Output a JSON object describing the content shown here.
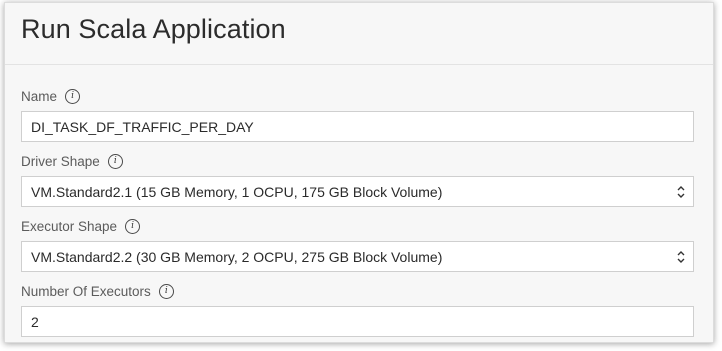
{
  "dialog": {
    "title": "Run Scala Application"
  },
  "fields": {
    "name": {
      "label": "Name",
      "value": "DI_TASK_DF_TRAFFIC_PER_DAY"
    },
    "driver_shape": {
      "label": "Driver Shape",
      "value": "VM.Standard2.1 (15 GB Memory, 1 OCPU, 175 GB Block Volume)"
    },
    "executor_shape": {
      "label": "Executor Shape",
      "value": "VM.Standard2.2 (30 GB Memory, 2 OCPU, 275 GB Block Volume)"
    },
    "num_executors": {
      "label": "Number Of Executors",
      "value": "2"
    }
  },
  "icons": {
    "info": "info-icon",
    "select_arrows": "chevron-up-down-icon"
  },
  "colors": {
    "panel_bg": "#f7f7f7",
    "input_bg": "#ffffff",
    "input_border": "#cfcfcf",
    "label_text": "#5b5b5b",
    "title_text": "#2c2c2c"
  }
}
